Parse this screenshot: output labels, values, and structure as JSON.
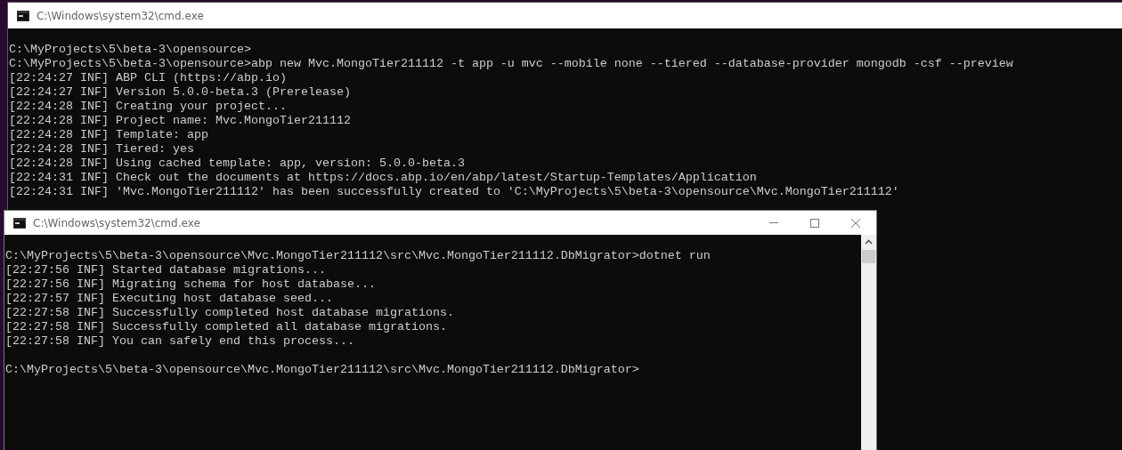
{
  "windows": [
    {
      "title": "C:\\Windows\\system32\\cmd.exe",
      "kind": "background",
      "blocks": [
        [
          "C:\\MyProjects\\5\\beta-3\\opensource>",
          "C:\\MyProjects\\5\\beta-3\\opensource>abp new Mvc.MongoTier211112 -t app -u mvc --mobile none --tiered --database-provider mongodb -csf --preview",
          "[22:24:27 INF] ABP CLI (https://abp.io)",
          "[22:24:27 INF] Version 5.0.0-beta.3 (Prerelease)",
          "[22:24:28 INF] Creating your project...",
          "[22:24:28 INF] Project name: Mvc.MongoTier211112",
          "[22:24:28 INF] Template: app",
          "[22:24:28 INF] Tiered: yes",
          "[22:24:28 INF] Using cached template: app, version: 5.0.0-beta.3",
          "[22:24:31 INF] Check out the documents at https://docs.abp.io/en/abp/latest/Startup-Templates/Application",
          "[22:24:31 INF] 'Mvc.MongoTier211112' has been successfully created to 'C:\\MyProjects\\5\\beta-3\\opensource\\Mvc.MongoTier211112'"
        ]
      ]
    },
    {
      "title": "C:\\Windows\\system32\\cmd.exe",
      "kind": "foreground",
      "blocks": [
        [
          "C:\\MyProjects\\5\\beta-3\\opensource\\Mvc.MongoTier211112\\src\\Mvc.MongoTier211112.DbMigrator>dotnet run",
          "[22:27:56 INF] Started database migrations...",
          "[22:27:56 INF] Migrating schema for host database...",
          "[22:27:57 INF] Executing host database seed...",
          "[22:27:58 INF] Successfully completed host database migrations.",
          "[22:27:58 INF] Successfully completed all database migrations.",
          "[22:27:58 INF] You can safely end this process..."
        ],
        [
          "C:\\MyProjects\\5\\beta-3\\opensource\\Mvc.MongoTier211112\\src\\Mvc.MongoTier211112.DbMigrator>"
        ]
      ]
    }
  ]
}
